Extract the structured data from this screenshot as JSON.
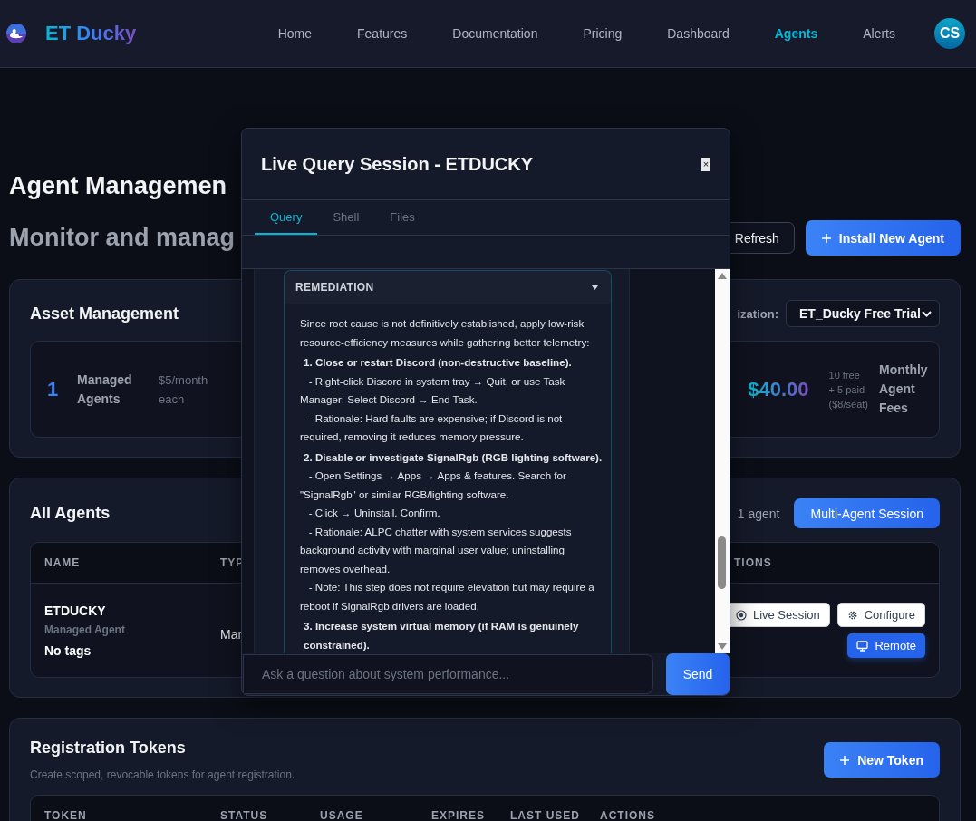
{
  "nav": {
    "brand": "ET Ducky",
    "links": [
      {
        "label": "Home",
        "selected": false
      },
      {
        "label": "Features",
        "selected": false
      },
      {
        "label": "Documentation",
        "selected": false
      },
      {
        "label": "Pricing",
        "selected": false
      },
      {
        "label": "Dashboard",
        "selected": false
      },
      {
        "label": "Agents",
        "selected": true
      },
      {
        "label": "Alerts",
        "selected": false
      }
    ],
    "avatar": "CS"
  },
  "page": {
    "title": "Agent Managemen",
    "subtitle": "Monitor and manag",
    "buttons": [
      {
        "label": "Refresh",
        "kind": "secondary"
      },
      {
        "label": "Install New Agent",
        "kind": "add"
      }
    ]
  },
  "asset": {
    "title": "Asset Management",
    "org_label": "ization:",
    "org_value": "ET_Ducky Free Trial",
    "count": "1",
    "count_label": "Managed Agents",
    "price": "$5/month each",
    "total": "$40.00",
    "breakdown": [
      "10 free",
      "+ 5 paid",
      "($8/seat)"
    ],
    "total_label": "Monthly Agent Fees"
  },
  "agents": {
    "title": "All Agents",
    "count": "1 agent",
    "button": {
      "label": "Multi-Agent Session",
      "kind": "primary"
    },
    "columns": [
      "NAME",
      "TYP",
      "TIONS"
    ],
    "rows": [
      {
        "name": "ETDUCKY",
        "subtitle": "Managed Agent",
        "tags": "No tags",
        "column_2": "Mar",
        "actions": [
          {
            "label": "Live Session",
            "kind": "live"
          },
          {
            "label": "Configure",
            "kind": "configure"
          },
          {
            "label": "Remote",
            "kind": "remote"
          }
        ]
      }
    ]
  },
  "tokens": {
    "title": "Registration Tokens",
    "description": "Create scoped, revocable tokens for agent registration.",
    "button": {
      "label": "New Token",
      "kind": "add"
    },
    "columns": [
      "TOKEN",
      "STATUS",
      "USAGE",
      "EXPIRES",
      "LAST USED",
      "ACTIONS"
    ]
  },
  "modal": {
    "title": "Live Query Session - ETDUCKY",
    "close": "×",
    "tabs": [
      {
        "label": "Query",
        "selected": true
      },
      {
        "label": "Shell",
        "selected": false
      },
      {
        "label": "Files",
        "selected": false
      }
    ],
    "section": {
      "title": "REMEDIATION",
      "expanded": true,
      "items": [
        {
          "kind": "text",
          "text": "Since root cause is not definitively established, apply low-risk resource-efficiency measures while gathering better telemetry:"
        },
        {
          "kind": "step",
          "text": "1. Close or restart Discord (non-destructive baseline)."
        },
        {
          "kind": "text",
          "text": "   - Right-click Discord in system tray → Quit, or use Task Manager: Select Discord → End Task."
        },
        {
          "kind": "text",
          "text": "   - Rationale: Hard faults are expensive; if Discord is not required, removing it reduces memory pressure."
        },
        {
          "kind": "step",
          "text": "2. Disable or investigate SignalRgb (RGB lighting software)."
        },
        {
          "kind": "text",
          "text": "   - Open Settings → Apps → Apps & features. Search for \"SignalRgb\" or similar RGB/lighting software."
        },
        {
          "kind": "text",
          "text": "   - Click → Uninstall. Confirm."
        },
        {
          "kind": "text",
          "text": "   - Rationale: ALPC chatter with system services suggests background activity with marginal user value; uninstalling removes overhead."
        },
        {
          "kind": "text",
          "text": "   - Note: This step does not require elevation but may require a reboot if SignalRgb drivers are loaded."
        },
        {
          "kind": "step",
          "text": "3. Increase system virtual memory (if RAM is genuinely constrained)."
        }
      ]
    },
    "input": {
      "placeholder": "Ask a question about system performance..."
    },
    "send": "Send"
  }
}
